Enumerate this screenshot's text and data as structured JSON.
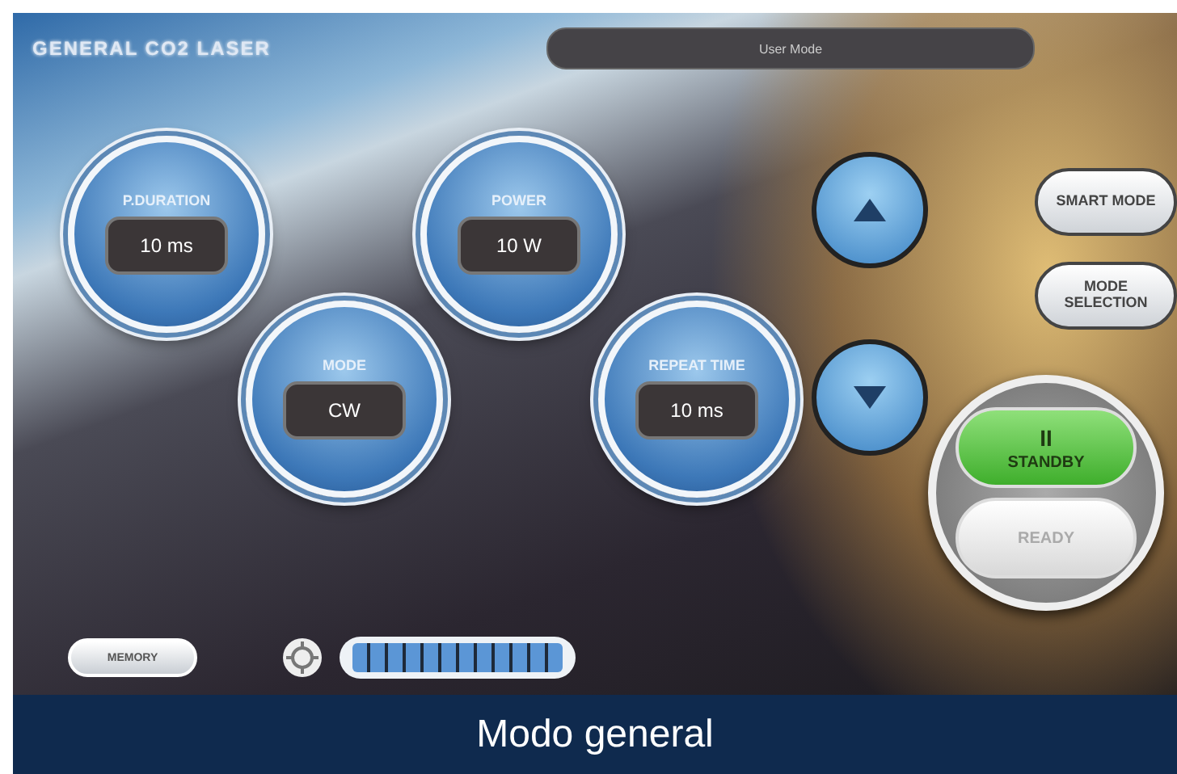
{
  "screen": {
    "title": "GENERAL CO2 LASER",
    "mode_bar": "User Mode",
    "dials": [
      {
        "label": "P.DURATION",
        "value": "10 ms"
      },
      {
        "label": "POWER",
        "value": "10 W"
      },
      {
        "label": "MODE",
        "value": "CW"
      },
      {
        "label": "REPEAT TIME",
        "value": "10 ms"
      }
    ],
    "arrows": [
      {
        "kind": "up"
      },
      {
        "kind": "down"
      }
    ],
    "side_buttons": [
      "SMART MODE",
      "MODE SELECTION"
    ],
    "state_buttons": [
      {
        "label": "STANDBY",
        "icon": "II",
        "selected": true
      },
      {
        "label": "READY",
        "selected": false
      }
    ],
    "memory_button": "MEMORY",
    "energy": {
      "level": 1
    }
  },
  "caption": "Modo general"
}
